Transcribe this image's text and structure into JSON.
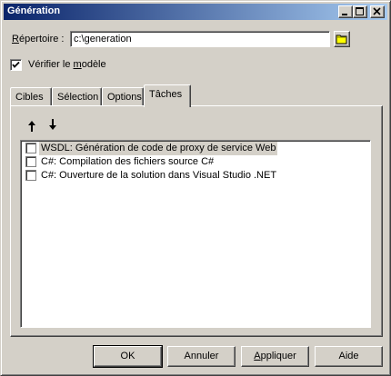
{
  "window": {
    "title": "Génération"
  },
  "directory": {
    "label_prefix": "R",
    "label_rest": "épertoire :",
    "value": "c:\\generation"
  },
  "verify": {
    "label_start": "Vérifier le ",
    "label_mnemonic": "m",
    "label_end": "odèle",
    "checked": true
  },
  "tabs": [
    {
      "label": "Cibles"
    },
    {
      "label": "Sélection"
    },
    {
      "label": "Options"
    },
    {
      "label": "Tâches",
      "active": true
    }
  ],
  "toolbar": {
    "move_up_icon": "arrow-up-icon",
    "move_down_icon": "arrow-down-icon"
  },
  "tasks": [
    {
      "label": "WSDL: Génération de code de proxy de service Web",
      "checked": false,
      "selected": true
    },
    {
      "label": "C#: Compilation des fichiers source C#",
      "checked": false
    },
    {
      "label": "C#: Ouverture de la solution dans Visual Studio .NET",
      "checked": false
    }
  ],
  "buttons": {
    "ok": "OK",
    "cancel": "Annuler",
    "apply_mnemonic": "A",
    "apply_rest": "ppliquer",
    "help": "Aide"
  }
}
